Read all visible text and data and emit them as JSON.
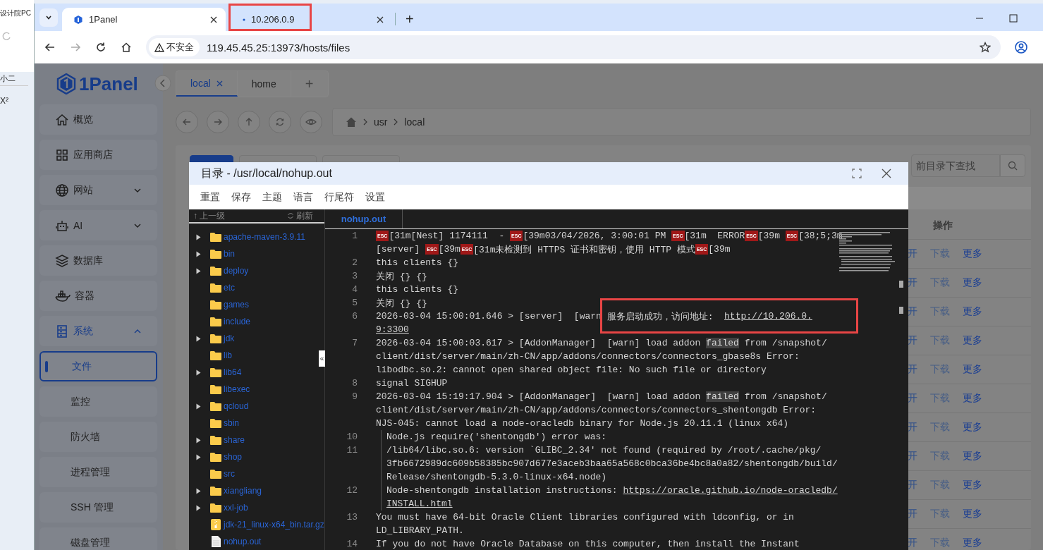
{
  "background_window": {
    "texts": [
      "设计院PC",
      "小二",
      "X²"
    ]
  },
  "browser": {
    "tabs": [
      {
        "title": "1Panel",
        "selected": true
      },
      {
        "title": "10.206.0.9",
        "selected": false
      }
    ],
    "new_tab": "+",
    "address": {
      "security": "不安全",
      "url": "119.45.45.25:13973/hosts/files"
    }
  },
  "sidebar": {
    "logo": "1Panel",
    "items": [
      {
        "label": "概览",
        "kind": "item",
        "selected": false
      },
      {
        "label": "应用商店",
        "kind": "item",
        "selected": false
      },
      {
        "label": "网站",
        "kind": "item",
        "selected": false,
        "expanded": false
      },
      {
        "label": "AI",
        "kind": "item",
        "selected": false,
        "expanded": false
      },
      {
        "label": "数据库",
        "kind": "item",
        "selected": false
      },
      {
        "label": "容器",
        "kind": "item",
        "selected": false
      },
      {
        "label": "系统",
        "kind": "item",
        "selected": false,
        "expanded": true
      },
      {
        "label": "文件",
        "kind": "sub",
        "selected": true
      },
      {
        "label": "监控",
        "kind": "sub",
        "selected": false
      },
      {
        "label": "防火墙",
        "kind": "sub",
        "selected": false
      },
      {
        "label": "进程管理",
        "kind": "sub",
        "selected": false
      },
      {
        "label": "SSH 管理",
        "kind": "sub",
        "selected": false
      },
      {
        "label": "磁盘管理",
        "kind": "sub",
        "selected": false
      }
    ]
  },
  "file_tabs": {
    "tabs": [
      {
        "label": "local",
        "selected": true
      },
      {
        "label": "home",
        "selected": false
      }
    ],
    "add": "+"
  },
  "breadcrumb": [
    "usr",
    "local"
  ],
  "search": {
    "placeholder": "前目录下查找"
  },
  "table": {
    "header": "操作",
    "rows": [
      {
        "cells": [
          "开",
          "下载",
          "更多"
        ]
      },
      {
        "cells": [
          "开",
          "下载",
          "更多"
        ]
      },
      {
        "cells": [
          "开",
          "下载",
          "更多"
        ]
      },
      {
        "cells": [
          "开",
          "下载",
          "更多"
        ]
      },
      {
        "cells": [
          "开",
          "下载",
          "更多"
        ]
      },
      {
        "cells": [
          "开",
          "下载",
          "更多"
        ]
      },
      {
        "cells": [
          "开",
          "下载",
          "更多"
        ]
      },
      {
        "cells": [
          "开",
          "下载",
          "更多"
        ]
      },
      {
        "cells": [
          "开",
          "下载",
          "更多"
        ]
      },
      {
        "cells": [
          "开",
          "下载",
          "更多"
        ]
      },
      {
        "cells": [
          "开",
          "下载",
          "更多"
        ]
      }
    ]
  },
  "modal": {
    "title": "目录 - /usr/local/nohup.out",
    "menu": [
      "重置",
      "保存",
      "主题",
      "语言",
      "行尾符",
      "设置"
    ],
    "tree": {
      "up": "↑ 上一级",
      "refresh": "刷新",
      "items": [
        {
          "name": "apache-maven-3.9.11",
          "kind": "folder",
          "expandable": true
        },
        {
          "name": "bin",
          "kind": "folder",
          "expandable": true
        },
        {
          "name": "deploy",
          "kind": "folder",
          "expandable": true
        },
        {
          "name": "etc",
          "kind": "folder",
          "expandable": false
        },
        {
          "name": "games",
          "kind": "folder",
          "expandable": false
        },
        {
          "name": "include",
          "kind": "folder",
          "expandable": false
        },
        {
          "name": "jdk",
          "kind": "folder",
          "expandable": true
        },
        {
          "name": "lib",
          "kind": "folder",
          "expandable": false
        },
        {
          "name": "lib64",
          "kind": "folder",
          "expandable": true
        },
        {
          "name": "libexec",
          "kind": "folder",
          "expandable": false
        },
        {
          "name": "qcloud",
          "kind": "folder",
          "expandable": true
        },
        {
          "name": "sbin",
          "kind": "folder",
          "expandable": false
        },
        {
          "name": "share",
          "kind": "folder",
          "expandable": true
        },
        {
          "name": "shop",
          "kind": "folder",
          "expandable": true
        },
        {
          "name": "src",
          "kind": "folder",
          "expandable": false
        },
        {
          "name": "xiangliang",
          "kind": "folder",
          "expandable": true
        },
        {
          "name": "xxl-job",
          "kind": "folder",
          "expandable": true
        },
        {
          "name": "jdk-21_linux-x64_bin.tar.gz",
          "kind": "archive",
          "expandable": false
        },
        {
          "name": "nohup.out",
          "kind": "file",
          "expandable": false
        }
      ]
    },
    "collapse_toggle": "«",
    "editor": {
      "tabs": [
        {
          "label": "nohup.out",
          "selected": true
        }
      ],
      "lines": [
        {
          "number": "1",
          "indented": false,
          "rows": [
            {
              "segments": [
                {
                  "kind": "esc",
                  "text": "ESC"
                },
                {
                  "kind": "text",
                  "text": "[31m[Nest] 1174111  - "
                },
                {
                  "kind": "esc",
                  "text": "ESC"
                },
                {
                  "kind": "text",
                  "text": "[39m03/04/2026, 3:00:01 PM "
                },
                {
                  "kind": "esc",
                  "text": "ESC"
                },
                {
                  "kind": "text",
                  "text": "[31m  ERROR"
                },
                {
                  "kind": "esc",
                  "text": "ESC"
                },
                {
                  "kind": "text",
                  "text": "[39m "
                },
                {
                  "kind": "esc",
                  "text": "ESC"
                },
                {
                  "kind": "text",
                  "text": "[38;5;3m"
                }
              ]
            },
            {
              "segments": [
                {
                  "kind": "text",
                  "text": "[server] "
                },
                {
                  "kind": "esc",
                  "text": "ESC"
                },
                {
                  "kind": "text",
                  "text": "[39m"
                },
                {
                  "kind": "esc",
                  "text": "ESC"
                },
                {
                  "kind": "text",
                  "text": "[31m未检测到 HTTPS 证书和密钥，使用 HTTP 模式"
                },
                {
                  "kind": "esc",
                  "text": "ESC"
                },
                {
                  "kind": "text",
                  "text": "[39m"
                }
              ]
            }
          ]
        },
        {
          "number": "2",
          "indented": false,
          "rows": [
            {
              "segments": [
                {
                  "kind": "text",
                  "text": "this clients {}"
                }
              ]
            }
          ]
        },
        {
          "number": "3",
          "indented": false,
          "rows": [
            {
              "segments": [
                {
                  "kind": "text",
                  "text": "关闭 {} {}"
                }
              ]
            }
          ]
        },
        {
          "number": "4",
          "indented": false,
          "rows": [
            {
              "segments": [
                {
                  "kind": "text",
                  "text": "this clients {}"
                }
              ]
            }
          ]
        },
        {
          "number": "5",
          "indented": false,
          "rows": [
            {
              "segments": [
                {
                  "kind": "text",
                  "text": "关闭 {} {}"
                }
              ]
            }
          ]
        },
        {
          "number": "6",
          "indented": false,
          "rows": [
            {
              "segments": [
                {
                  "kind": "text",
                  "text": "2026-03-04 15:00:01.646 > [server]  [warn "
                },
                {
                  "kind": "text",
                  "text": "服务启动成功，访问地址:  "
                },
                {
                  "kind": "link",
                  "text": "http://10.206.0."
                }
              ]
            },
            {
              "segments": [
                {
                  "kind": "link",
                  "text": "9:3300"
                }
              ]
            }
          ]
        },
        {
          "number": "7",
          "indented": false,
          "rows": [
            {
              "segments": [
                {
                  "kind": "text",
                  "text": "2026-03-04 15:00:03.617 > [AddonManager]  [warn] load addon "
                },
                {
                  "kind": "match",
                  "text": "failed"
                },
                {
                  "kind": "text",
                  "text": " from /snapshot/"
                }
              ]
            },
            {
              "segments": [
                {
                  "kind": "text",
                  "text": "client/dist/server/main/zh-CN/app/addons/connectors/connectors_gbase8s Error:"
                }
              ]
            },
            {
              "segments": [
                {
                  "kind": "text",
                  "text": "libodbc.so.2: cannot open shared object file: No such file or directory"
                }
              ]
            }
          ]
        },
        {
          "number": "8",
          "indented": false,
          "rows": [
            {
              "segments": [
                {
                  "kind": "text",
                  "text": "signal SIGHUP"
                }
              ]
            }
          ]
        },
        {
          "number": "9",
          "indented": false,
          "rows": [
            {
              "segments": [
                {
                  "kind": "text",
                  "text": "2026-03-04 15:19:17.904 > [AddonManager]  [warn] load addon "
                },
                {
                  "kind": "match",
                  "text": "failed"
                },
                {
                  "kind": "text",
                  "text": " from /snapshot/"
                }
              ]
            },
            {
              "segments": [
                {
                  "kind": "text",
                  "text": "client/dist/server/main/zh-CN/app/addons/connectors/connectors_shentongdb Error:"
                }
              ]
            },
            {
              "segments": [
                {
                  "kind": "text",
                  "text": "NJS-045: cannot load a node-oracledb binary for Node.js 20.11.1 (linux x64)"
                }
              ]
            }
          ]
        },
        {
          "number": "10",
          "indented": true,
          "rows": [
            {
              "segments": [
                {
                  "kind": "text",
                  "text": "Node.js require('shentongdb') error was:"
                }
              ]
            }
          ]
        },
        {
          "number": "11",
          "indented": true,
          "rows": [
            {
              "segments": [
                {
                  "kind": "text",
                  "text": "/lib64/libc.so.6: version `GLIBC_2.34' not found (required by /root/.cache/pkg/"
                }
              ]
            },
            {
              "segments": [
                {
                  "kind": "text",
                  "text": "3fb6672989dc609b58385bc907d677e3aceb3baa65a568c0bca36be4bc8a0a82/shentongdb/build/"
                }
              ]
            },
            {
              "segments": [
                {
                  "kind": "text",
                  "text": "Release/shentongdb-5.3.0-linux-x64.node)"
                }
              ]
            }
          ]
        },
        {
          "number": "12",
          "indented": true,
          "rows": [
            {
              "segments": [
                {
                  "kind": "text",
                  "text": "Node-shentongdb installation instructions: "
                },
                {
                  "kind": "link",
                  "text": "https://oracle.github.io/node-oracledb/"
                }
              ]
            },
            {
              "segments": [
                {
                  "kind": "link",
                  "text": "INSTALL.html"
                }
              ]
            }
          ]
        },
        {
          "number": "13",
          "indented": false,
          "rows": [
            {
              "segments": [
                {
                  "kind": "text",
                  "text": "You must have 64-bit Oracle Client libraries configured with ldconfig, or in"
                }
              ]
            },
            {
              "segments": [
                {
                  "kind": "text",
                  "text": "LD_LIBRARY_PATH."
                }
              ]
            }
          ]
        },
        {
          "number": "14",
          "indented": false,
          "rows": [
            {
              "segments": [
                {
                  "kind": "text",
                  "text": "If you do not have Oracle Database on this computer, then install the Instant"
                }
              ]
            }
          ]
        }
      ]
    }
  }
}
